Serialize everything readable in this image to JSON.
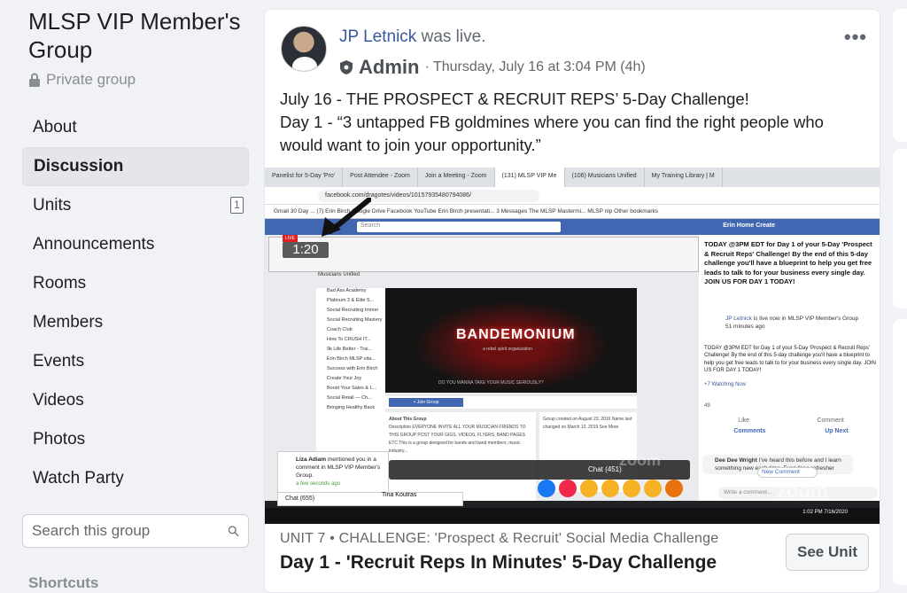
{
  "sidebar": {
    "group_title": "MLSP VIP Member's Group",
    "privacy": "Private group",
    "items": [
      {
        "label": "About"
      },
      {
        "label": "Discussion"
      },
      {
        "label": "Units",
        "badge": "1"
      },
      {
        "label": "Announcements"
      },
      {
        "label": "Rooms"
      },
      {
        "label": "Members"
      },
      {
        "label": "Events"
      },
      {
        "label": "Videos"
      },
      {
        "label": "Photos"
      },
      {
        "label": "Watch Party"
      }
    ],
    "search_placeholder": "Search this group",
    "shortcuts": "Shortcuts"
  },
  "post": {
    "author": "JP Letnick",
    "action": "was live.",
    "role": "Admin",
    "timestamp": "· Thursday, July 16 at 3:04 PM (4h)",
    "more": "•••",
    "text_lines": [
      "July 16 - THE PROSPECT & RECRUIT REPS’ 5-Day Challenge!",
      "Day 1 - “3 untapped FB goldmines where you can find the right people who",
      "would want to join your opportunity.”"
    ]
  },
  "video": {
    "browser_tabs": [
      "Panelist for 5-Day 'Pro'",
      "Post Attendee - Zoom",
      "Join a Meeting - Zoom",
      "(131) MLSP VIP Me",
      "(106) Musicians Unified",
      "My Training Library | M"
    ],
    "url": "facebook.com/dragotes/videos/10157935480794086/",
    "bookmarks": "Gmail   30 Day ...   (7) Erin Birch   Google Drive   Facebook   YouTube   Erin Birch presentati...   3 Messages   The MLSP Mastermi...   MLSP   nlp        Other bookmarks",
    "fb_search": "Search",
    "fb_nav": "Erin    Home    Create",
    "timer": "1:20",
    "live_tag": "LIVE",
    "group_name": "Musicians Unified",
    "inner_sidebar": [
      "Bad Ass Academy",
      "Platinum 3 & Elite S...",
      "Social Recruiting Immer",
      "Social Recruiting Mastery",
      "Coach Club",
      "How To CRUSH IT...",
      "9k Life Better - Trai...",
      "Erin Birch MLSP vita...",
      "Success with Erin Birch",
      "Create Your Joy",
      "Boost Your Sales & L...",
      "Social Retail — Ch...",
      "Bringing Healthy Back"
    ],
    "band_logo": "BANDEMONIUM",
    "band_sub": "a rebel spirit organization",
    "band_question": "DO YOU WANNA TAKE YOUR MUSIC SERIOUSLY?",
    "join_label": "+ Join Group",
    "about_title": "About This Group",
    "about_text": "Description  EVERYONE INVITE ALL YOUR MUSICIAN FRIENDS TO THIS GROUP  POST YOUR GIGS, VIDEOS, FLYERS, BAND PAGES ETC  This is a group designed for bands and band members, music industry...",
    "about_right": "Group created on August 23, 2016  Name last changed on March 10, 2019  See More",
    "right_today": "TODAY @3PM EDT for Day 1 of your 5-Day 'Prospect & Recruit Reps' Challenge! By the end of this 5-day challenge you'll have a blueprint to help you get free leads to talk to for your business every single day. JOIN US FOR DAY 1 TODAY!",
    "live_author": "JP Letnick",
    "live_text": "is live now in MLSP VIP Member's Group",
    "live_time": "51 minutes ago",
    "right_today2": "TODAY @3PM EDT for Day 1 of your 5-Day 'Prospect & Recruit Reps' Challenge! By the end of this 5-day challenge you'll have a blueprint to help you get free leads to talk to for your business every single day. JOIN US FOR DAY 1 TODAY!",
    "watching": "+7   Watching Now",
    "likes": "49",
    "like_label": "Like",
    "comment_label": "Comment",
    "comments_tab": "Comments",
    "upnext_tab": "Up Next",
    "comment_author": "Dee Dee Wright",
    "comment_text": "I've heard this before and I learn something new each time. Even for a refresher",
    "new_comment": "New Comment",
    "write_comment": "Write a comment...",
    "notif_author": "Liza Adiam",
    "notif_text": "mentioned you in a comment in MLSP VIP Member's Group.",
    "notif_time": "a few seconds ago",
    "chat": "Chat (655)",
    "tina": "Tina Koutras",
    "comment_btn": "Comment",
    "zoom_watermark": "zoom",
    "chat_count": "Chat (451)",
    "clock": "1:02 PM\n7/16/2020"
  },
  "unit": {
    "label": "UNIT 7 • CHALLENGE: 'Prospect & Recruit' Social Media Challenge",
    "title": "Day 1 - 'Recruit Reps In Minutes' 5-Day Challenge",
    "button": "See Unit"
  },
  "colors": {
    "link_blue": "#385898",
    "fb_blue": "#4267b2",
    "background": "#f0f2f5"
  }
}
